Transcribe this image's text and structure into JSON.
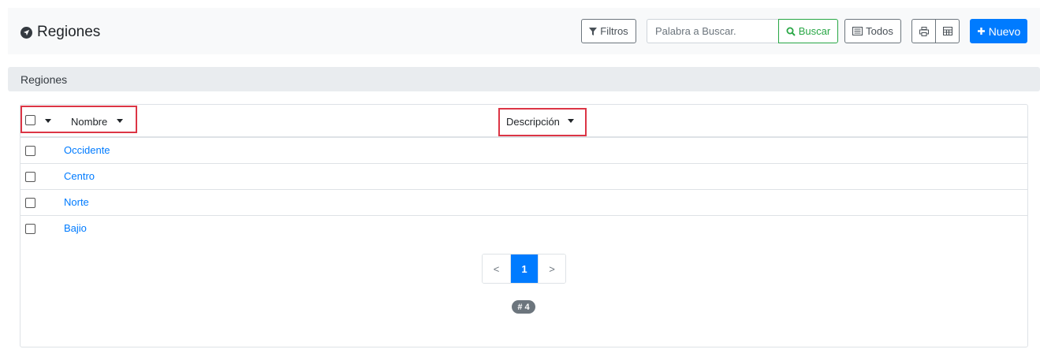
{
  "header": {
    "title": "Regiones",
    "title_icon": "location-arrow-icon",
    "toolbar": {
      "filtros_label": "Filtros",
      "search_placeholder": "Palabra a Buscar.",
      "buscar_label": "Buscar",
      "todos_label": "Todos",
      "nuevo_label": "Nuevo"
    }
  },
  "section": {
    "title": "Regiones"
  },
  "table": {
    "columns": [
      "Nombre",
      "Descripción"
    ],
    "rows": [
      {
        "nombre": "Occidente",
        "descripcion": ""
      },
      {
        "nombre": "Centro",
        "descripcion": ""
      },
      {
        "nombre": "Norte",
        "descripcion": ""
      },
      {
        "nombre": "Bajio",
        "descripcion": ""
      }
    ]
  },
  "pagination": {
    "prev": "<",
    "current": "1",
    "next": ">"
  },
  "record_count": "# 4",
  "colors": {
    "primary": "#007bff",
    "success": "#28a745",
    "highlight": "#dc3545"
  }
}
